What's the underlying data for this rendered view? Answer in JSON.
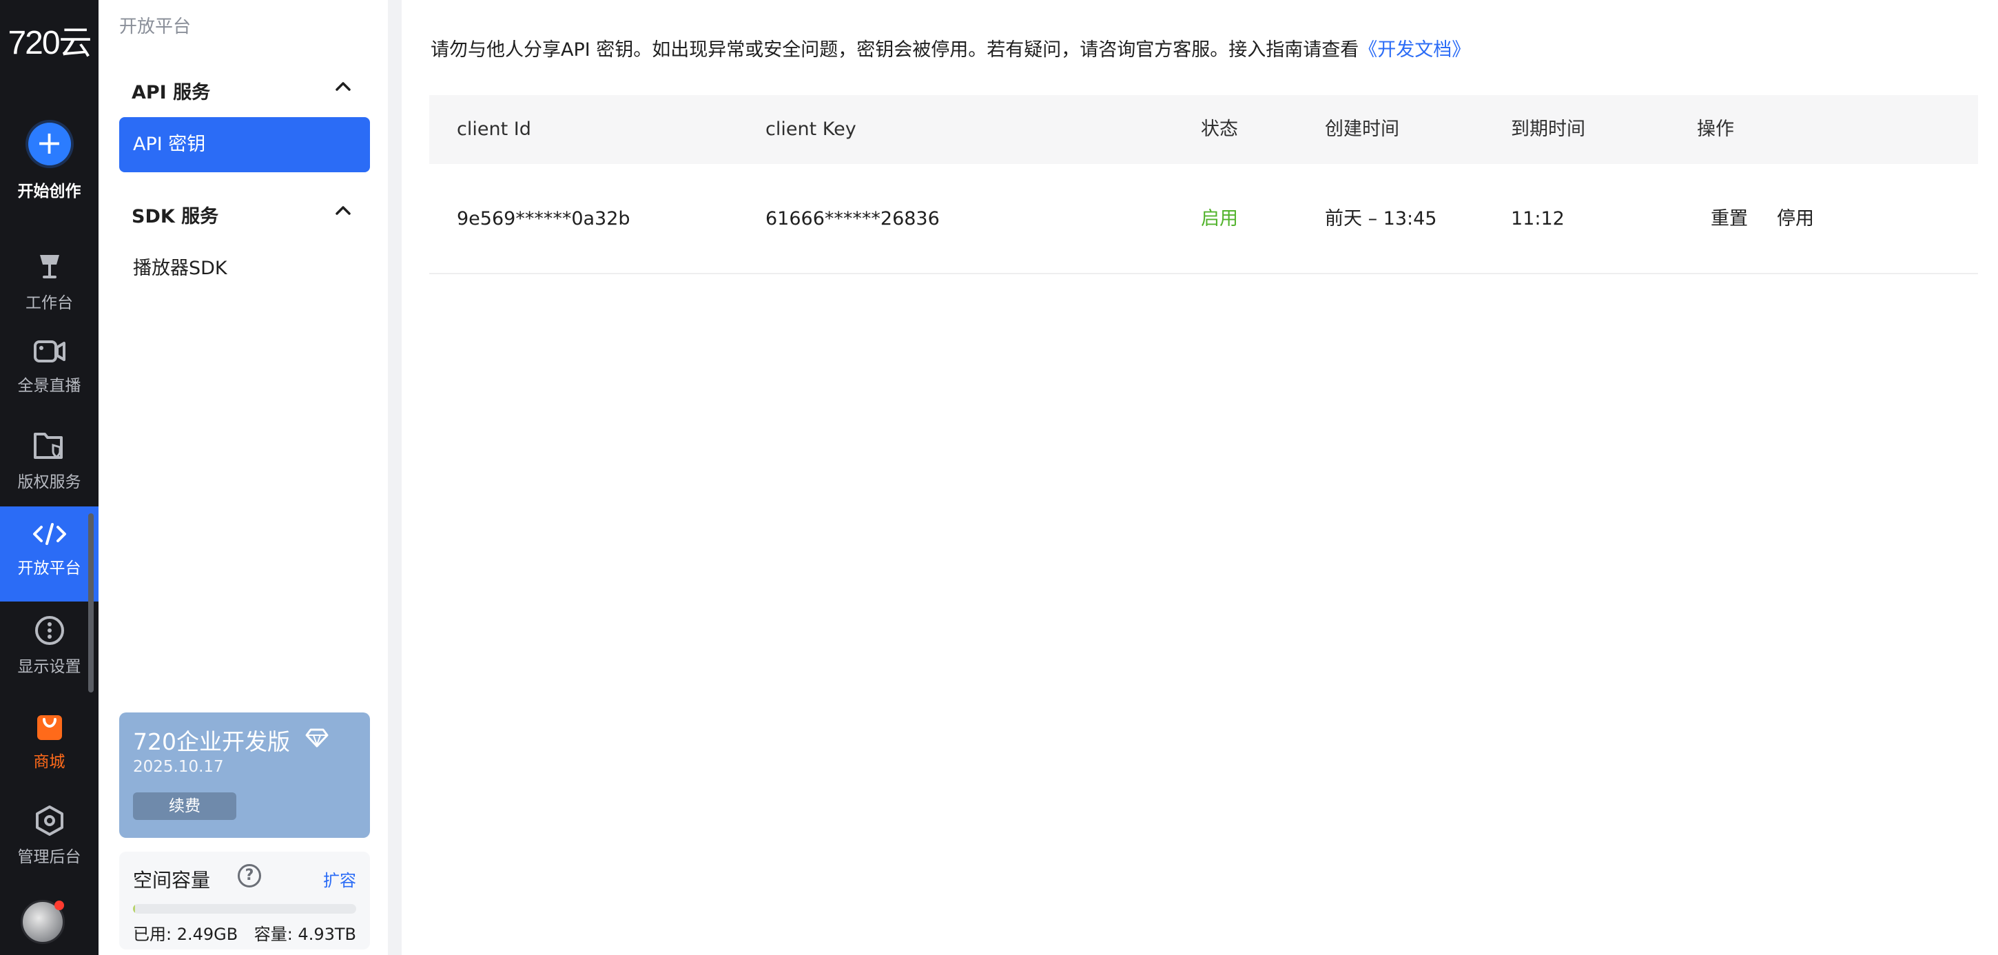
{
  "rail": {
    "logo": "720云",
    "create_label": "开始创作",
    "items": [
      {
        "label": "工作台"
      },
      {
        "label": "全景直播"
      },
      {
        "label": "版权服务"
      },
      {
        "label": "开放平台"
      },
      {
        "label": "显示设置"
      },
      {
        "label": "商城"
      },
      {
        "label": "管理后台"
      }
    ]
  },
  "sidebar": {
    "breadcrumb": "开放平台",
    "groups": [
      {
        "title": "API 服务",
        "items": [
          {
            "label": "API 密钥"
          }
        ]
      },
      {
        "title": "SDK 服务",
        "items": [
          {
            "label": "播放器SDK"
          }
        ]
      }
    ],
    "plan": {
      "title": "720企业开发版",
      "date": "2025.10.17",
      "renew_label": "续费"
    },
    "storage": {
      "title": "空间容量",
      "help": "?",
      "expand_label": "扩容",
      "used": "已用: 2.49GB",
      "capacity": "容量: 4.93TB",
      "used_fraction": 0.0005
    }
  },
  "main": {
    "notice_text": "请勿与他人分享API 密钥。如出现异常或安全问题，密钥会被停用。若有疑问，请咨询官方客服。接入指南请查看",
    "notice_link": "《开发文档》",
    "table": {
      "headers": {
        "client_id": "client Id",
        "client_key": "client Key",
        "status": "状态",
        "created": "创建时间",
        "expires": "到期时间",
        "actions": "操作"
      },
      "rows": [
        {
          "client_id": "9e569******0a32b",
          "client_key": "61666******26836",
          "status": "启用",
          "created": "前天 – 13:45",
          "expires": "11:12",
          "reset_label": "重置",
          "disable_label": "停用"
        }
      ]
    }
  },
  "colors": {
    "accent": "#2b6cf6",
    "rail_bg": "#16171b",
    "status_enabled": "#52b32c",
    "shop": "#ff6a1a"
  }
}
